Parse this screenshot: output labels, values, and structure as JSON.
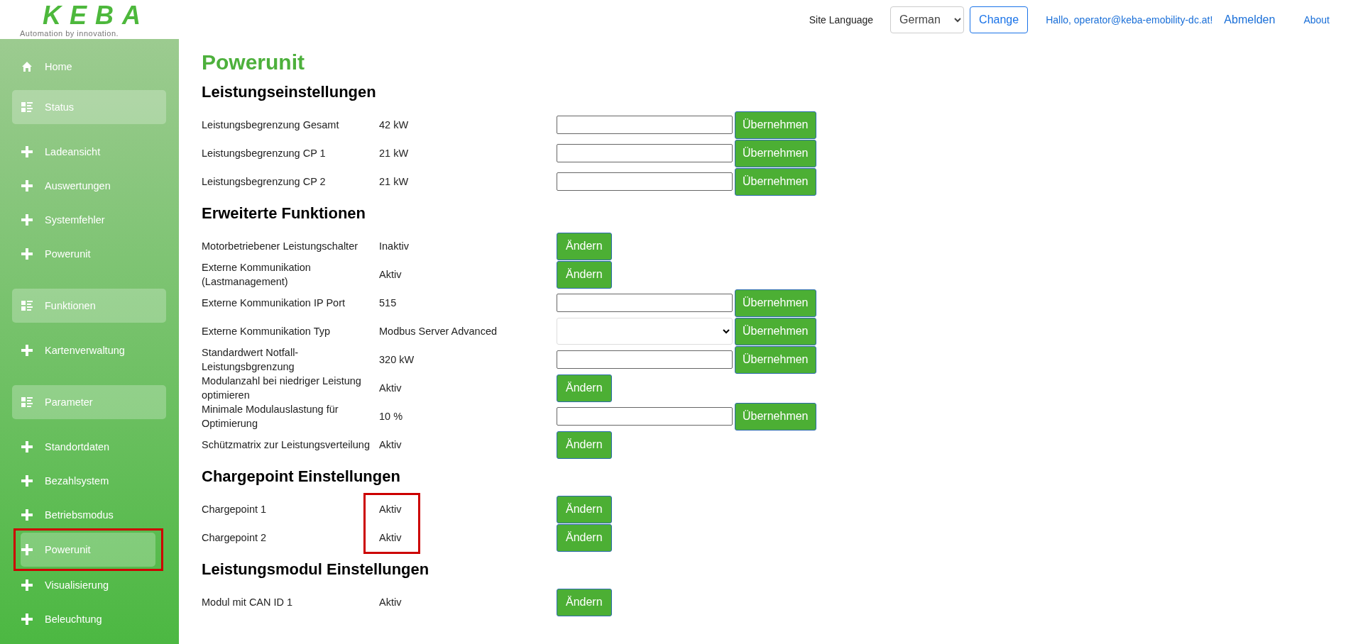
{
  "header": {
    "logo": {
      "wordmark": "KEBA",
      "tagline": "Automation by innovation."
    },
    "language_label": "Site Language",
    "language_select": {
      "value": "German"
    },
    "change_button": "Change",
    "greeting": "Hallo, operator@keba-emobility-dc.at!",
    "logout_link": "Abmelden",
    "about_link": "About"
  },
  "sidebar": {
    "items": [
      {
        "kind": "home",
        "label": "Home",
        "selected": false,
        "highlighted": false
      },
      {
        "kind": "group",
        "label": "Status",
        "selected": false,
        "highlighted": false
      },
      {
        "kind": "link",
        "label": "Ladeansicht",
        "selected": false,
        "highlighted": false
      },
      {
        "kind": "link",
        "label": "Auswertungen",
        "selected": false,
        "highlighted": false
      },
      {
        "kind": "link",
        "label": "Systemfehler",
        "selected": false,
        "highlighted": false
      },
      {
        "kind": "link",
        "label": "Powerunit",
        "selected": false,
        "highlighted": false
      },
      {
        "kind": "group",
        "label": "Funktionen",
        "selected": false,
        "highlighted": false
      },
      {
        "kind": "link",
        "label": "Kartenverwaltung",
        "selected": false,
        "highlighted": false
      },
      {
        "kind": "group",
        "label": "Parameter",
        "selected": false,
        "highlighted": false
      },
      {
        "kind": "link",
        "label": "Standortdaten",
        "selected": false,
        "highlighted": false
      },
      {
        "kind": "link",
        "label": "Bezahlsystem",
        "selected": false,
        "highlighted": false
      },
      {
        "kind": "link",
        "label": "Betriebsmodus",
        "selected": false,
        "highlighted": false
      },
      {
        "kind": "link",
        "label": "Powerunit",
        "selected": true,
        "highlighted": true
      },
      {
        "kind": "link",
        "label": "Visualisierung",
        "selected": false,
        "highlighted": false
      },
      {
        "kind": "link",
        "label": "Beleuchtung",
        "selected": false,
        "highlighted": false
      }
    ]
  },
  "page_title": "Powerunit",
  "sections": [
    {
      "title": "Leistungseinstellungen",
      "values_highlighted": false,
      "rows": [
        {
          "kind": "input",
          "label": "Leistungsbegrenzung Gesamt",
          "value": "42 kW",
          "button": "Übernehmen"
        },
        {
          "kind": "input",
          "label": "Leistungsbegrenzung CP 1",
          "value": "21 kW",
          "button": "Übernehmen"
        },
        {
          "kind": "input",
          "label": "Leistungsbegrenzung CP 2",
          "value": "21 kW",
          "button": "Übernehmen"
        }
      ]
    },
    {
      "title": "Erweiterte Funktionen",
      "values_highlighted": false,
      "rows": [
        {
          "kind": "toggle",
          "label": "Motorbetriebener Leistungschalter",
          "value": "Inaktiv",
          "button": "Ändern"
        },
        {
          "kind": "toggle",
          "label": "Externe Kommunikation (Lastmanagement)",
          "value": "Aktiv",
          "button": "Ändern"
        },
        {
          "kind": "input",
          "label": "Externe Kommunikation IP Port",
          "value": "515",
          "button": "Übernehmen"
        },
        {
          "kind": "select",
          "label": "Externe Kommunikation Typ",
          "value": "Modbus Server Advanced",
          "button": "Übernehmen"
        },
        {
          "kind": "input",
          "label": "Standardwert Notfall-Leistungsbgrenzung",
          "value": "320 kW",
          "button": "Übernehmen"
        },
        {
          "kind": "toggle",
          "label": "Modulanzahl bei niedriger Leistung optimieren",
          "value": "Aktiv",
          "button": "Ändern"
        },
        {
          "kind": "input",
          "label": "Minimale Modulauslastung für Optimierung",
          "value": "10 %",
          "button": "Übernehmen"
        },
        {
          "kind": "toggle",
          "label": "Schützmatrix zur Leistungsverteilung",
          "value": "Aktiv",
          "button": "Ändern"
        }
      ]
    },
    {
      "title": "Chargepoint Einstellungen",
      "values_highlighted": true,
      "rows": [
        {
          "kind": "toggle",
          "label": "Chargepoint 1",
          "value": "Aktiv",
          "button": "Ändern"
        },
        {
          "kind": "toggle",
          "label": "Chargepoint 2",
          "value": "Aktiv",
          "button": "Ändern"
        }
      ]
    },
    {
      "title": "Leistungsmodul Einstellungen",
      "values_highlighted": false,
      "rows": [
        {
          "kind": "toggle",
          "label": "Modul mit CAN ID 1",
          "value": "Aktiv",
          "button": "Ändern"
        }
      ]
    }
  ]
}
